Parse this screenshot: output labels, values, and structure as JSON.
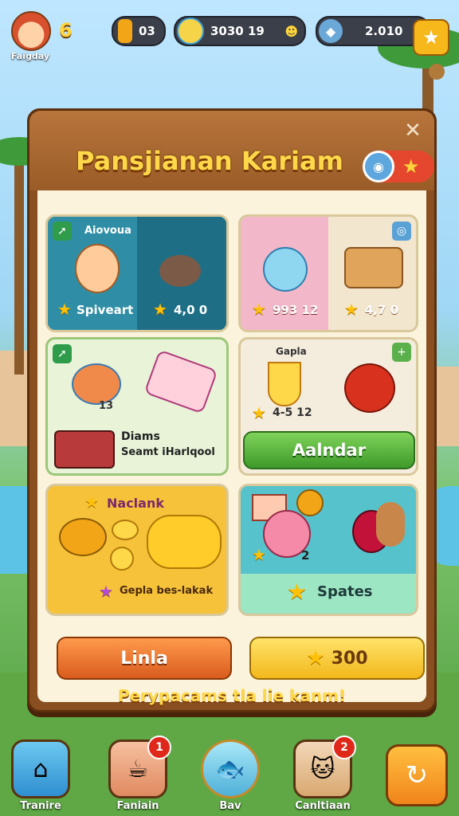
{
  "hud": {
    "player_name": "Faigday",
    "level": "6",
    "coins": "03",
    "drinks": "3030 19",
    "gems": "2.010"
  },
  "panel": {
    "title": "Pansjianan Kariam",
    "cards": [
      {
        "title": "Aiovoua",
        "label": "Spiveart",
        "value": "4,0 0"
      },
      {
        "value_left": "993 12",
        "value_right": "4,7 0"
      },
      {
        "count": "13",
        "caption_line1": "Diams",
        "caption_line2": "Seamt iHarlqool"
      },
      {
        "title": "Gapla",
        "value": "4-5 12",
        "button": "Aalndar"
      },
      {
        "title": "Naclank",
        "caption": "Gepla bes-lakak"
      },
      {
        "count": "2",
        "label": "Spates"
      }
    ],
    "btn_left": "Linla",
    "btn_right": "300",
    "footer": "Perypacams tla lie kanm!"
  },
  "nav": [
    {
      "label": "Tranire",
      "badge": ""
    },
    {
      "label": "Faniain",
      "badge": "1"
    },
    {
      "label": "Bav",
      "badge": ""
    },
    {
      "label": "Canltiaan",
      "badge": "2"
    }
  ],
  "colors": {
    "accent": "#f7b81b",
    "panel_wood": "#8a4f20",
    "title_text": "#ffd84a"
  }
}
